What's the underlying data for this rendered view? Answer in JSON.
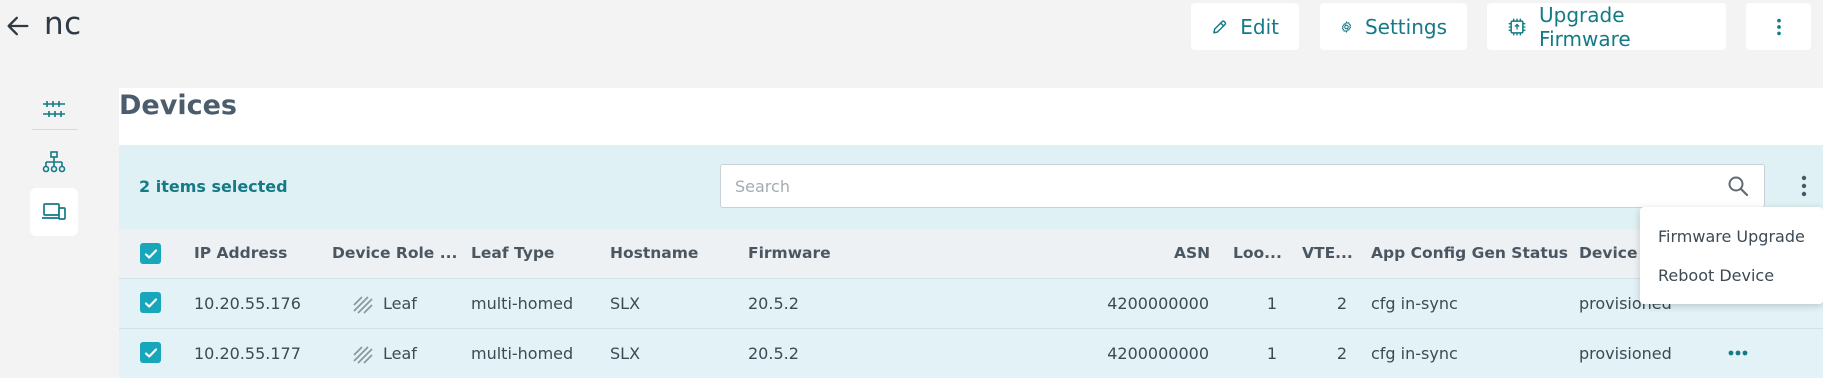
{
  "header": {
    "title": "nc",
    "buttons": {
      "edit": "Edit",
      "settings": "Settings",
      "upgrade_firmware": "Upgrade Firmware"
    }
  },
  "rail": {
    "items": [
      "sliders-icon",
      "topology-icon",
      "devices-icon"
    ],
    "active": "devices-icon"
  },
  "card": {
    "title": "Devices",
    "selected_text": "2 items selected",
    "search": {
      "placeholder": "Search",
      "value": ""
    }
  },
  "table": {
    "columns": [
      "IP Address",
      "Device Role ...",
      "Leaf Type",
      "Hostname",
      "Firmware",
      "ASN",
      "Loo...",
      "VTE...",
      "App Config Gen Status",
      "Device I"
    ],
    "rows": [
      {
        "checked": true,
        "ip": "10.20.55.176",
        "role": "Leaf",
        "leaf_type": "multi-homed",
        "hostname": "SLX",
        "firmware": "20.5.2",
        "asn": "4200000000",
        "loopback": "1",
        "vtep": "2",
        "app_config": "cfg in-sync",
        "device_state": "provisioned"
      },
      {
        "checked": true,
        "ip": "10.20.55.177",
        "role": "Leaf",
        "leaf_type": "multi-homed",
        "hostname": "SLX",
        "firmware": "20.5.2",
        "asn": "4200000000",
        "loopback": "1",
        "vtep": "2",
        "app_config": "cfg in-sync",
        "device_state": "provisioned"
      }
    ]
  },
  "menu": {
    "items": [
      "Firmware Upgrade",
      "Reboot Device"
    ]
  },
  "colors": {
    "accent": "#137a86",
    "checkbox": "#17a6ba",
    "toolbar_bg": "#dff1f4",
    "row_bg": "#e2f2f6"
  }
}
